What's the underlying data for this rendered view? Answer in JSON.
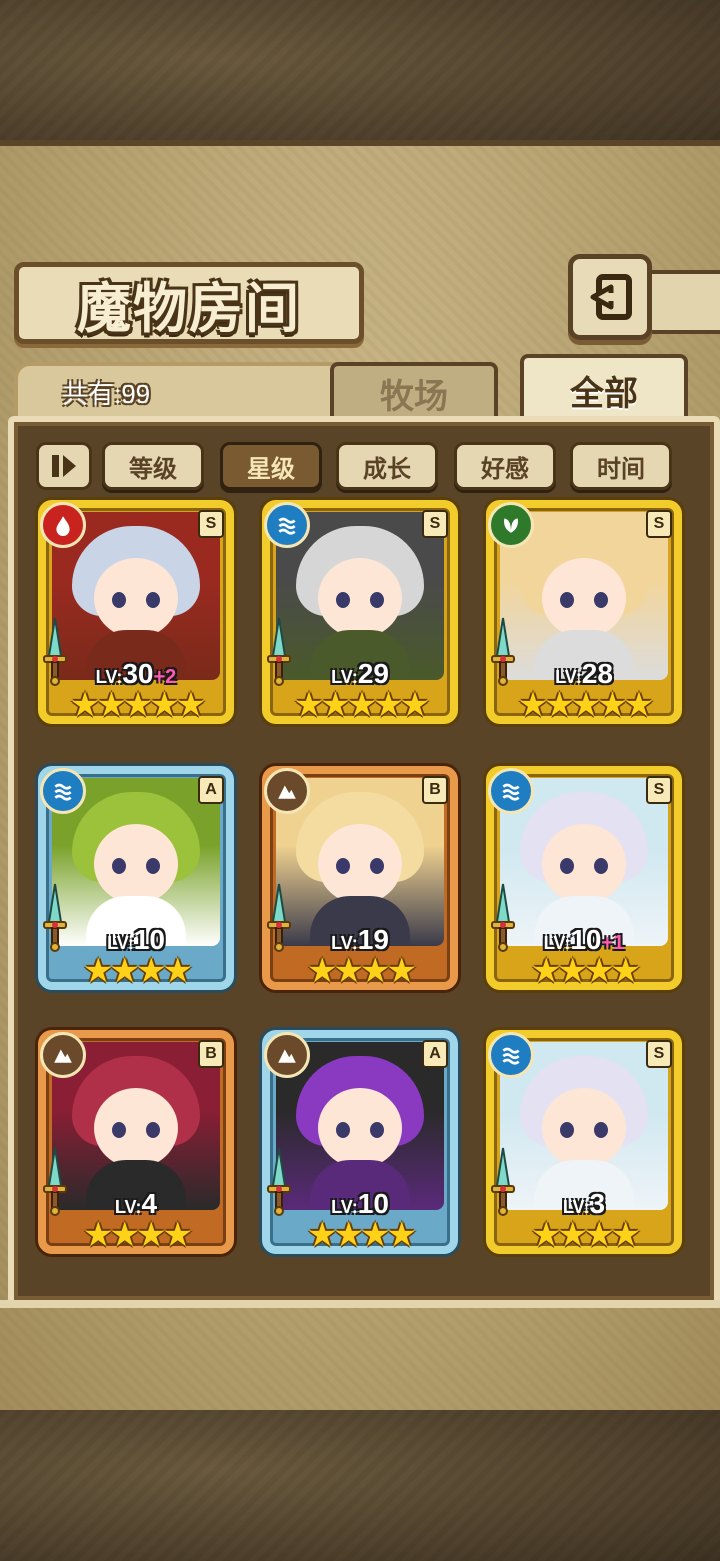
{
  "title": "魔物房间",
  "count_label": "共有:99",
  "tabs": [
    {
      "label": "牧场",
      "active": false
    },
    {
      "label": "全部",
      "active": true
    }
  ],
  "sort_buttons": [
    {
      "label": "等级",
      "active": false
    },
    {
      "label": "星级",
      "active": true
    },
    {
      "label": "成长",
      "active": false
    },
    {
      "label": "好感",
      "active": false
    },
    {
      "label": "时间",
      "active": false
    }
  ],
  "cards": [
    {
      "frame": "gold",
      "element": "fire",
      "element_color": "#c8231e",
      "rank": "S",
      "lv_label": "LV:",
      "level": "30",
      "bonus": "+2",
      "stars": "★★★★★",
      "star_count": 5,
      "hair": "#c9d4e6",
      "hood": "#9a2a20",
      "outfit": "#7a2a1a"
    },
    {
      "frame": "gold",
      "element": "water",
      "element_color": "#1f7ec2",
      "rank": "S",
      "lv_label": "LV:",
      "level": "29",
      "bonus": "",
      "stars": "★★★★★",
      "star_count": 5,
      "hair": "#d6d6d6",
      "hood": "#4a4a4a",
      "outfit": "#4a5a2a"
    },
    {
      "frame": "gold",
      "element": "leaf",
      "element_color": "#2e7a2a",
      "rank": "S",
      "lv_label": "LV:",
      "level": "28",
      "bonus": "",
      "stars": "★★★★★",
      "star_count": 5,
      "hair": "#f2d59a",
      "hood": "#f2d59a",
      "outfit": "#dcdcdc"
    },
    {
      "frame": "blue",
      "element": "water",
      "element_color": "#1f7ec2",
      "rank": "A",
      "lv_label": "LV:",
      "level": "10",
      "bonus": "",
      "stars": "★★★★",
      "star_count": 4,
      "hair": "#9bc23a",
      "hood": "#7aa22a",
      "outfit": "#ffffff"
    },
    {
      "frame": "bronze",
      "element": "earth",
      "element_color": "#6a4a2a",
      "rank": "B",
      "lv_label": "LV:",
      "level": "19",
      "bonus": "",
      "stars": "★★★★",
      "star_count": 4,
      "hair": "#f4dca0",
      "hood": "#f0d290",
      "outfit": "#3a3a4a"
    },
    {
      "frame": "gold",
      "element": "water",
      "element_color": "#1f7ec2",
      "rank": "S",
      "lv_label": "LV:",
      "level": "10",
      "bonus": "+1",
      "stars": "★★★★",
      "star_count": 4,
      "hair": "#e4e2f2",
      "hood": "#d0e8f0",
      "outfit": "#eef4f8"
    },
    {
      "frame": "bronze",
      "element": "earth",
      "element_color": "#6a4a2a",
      "rank": "B",
      "lv_label": "LV:",
      "level": "4",
      "bonus": "",
      "stars": "★★★★",
      "star_count": 4,
      "hair": "#b0304a",
      "hood": "#8a1e34",
      "outfit": "#2a2a2a"
    },
    {
      "frame": "blue",
      "element": "earth",
      "element_color": "#6a4a2a",
      "rank": "A",
      "lv_label": "LV:",
      "level": "10",
      "bonus": "",
      "stars": "★★★★",
      "star_count": 4,
      "hair": "#8a3ac0",
      "hood": "#2a2a2a",
      "outfit": "#5a2a7a"
    },
    {
      "frame": "gold",
      "element": "water",
      "element_color": "#1f7ec2",
      "rank": "S",
      "lv_label": "LV:",
      "level": "3",
      "bonus": "",
      "stars": "★★★★",
      "star_count": 4,
      "hair": "#e4e2f2",
      "hood": "#d0e8f0",
      "outfit": "#eef4f8"
    }
  ]
}
